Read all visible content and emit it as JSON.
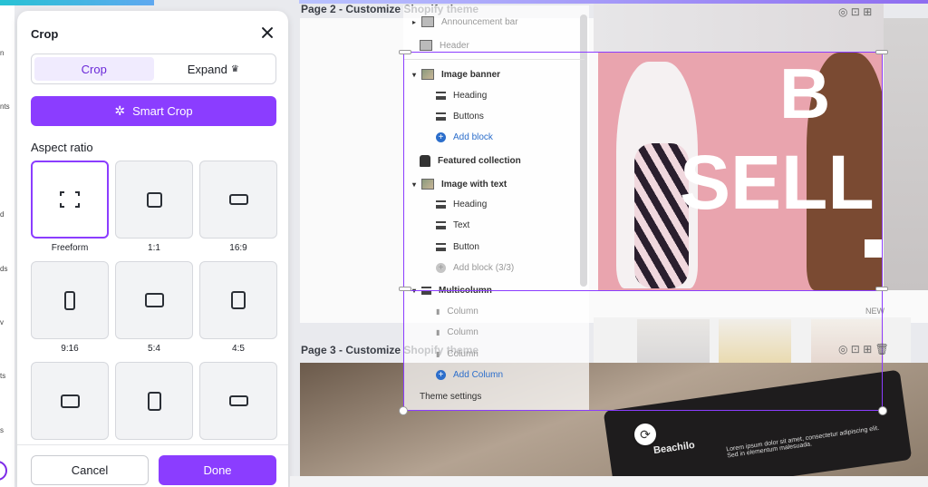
{
  "rail": {
    "labels": [
      "n",
      "nts",
      "d",
      "ds",
      "v",
      "ts",
      "s"
    ]
  },
  "panel": {
    "title": "Crop",
    "tabs": [
      {
        "label": "Crop",
        "active": true
      },
      {
        "label": "Expand",
        "icon": "crown-icon"
      }
    ],
    "smart_crop_label": "Smart Crop",
    "aspect_ratio_label": "Aspect ratio",
    "ratios": [
      {
        "label": "Freeform",
        "selected": true
      },
      {
        "label": "1:1"
      },
      {
        "label": "16:9"
      },
      {
        "label": "9:16"
      },
      {
        "label": "5:4"
      },
      {
        "label": "4:5"
      },
      {
        "label": ""
      },
      {
        "label": ""
      },
      {
        "label": ""
      }
    ],
    "cancel_label": "Cancel",
    "done_label": "Done"
  },
  "canvas": {
    "page2_title": "Page 2 - Customize Shopify theme",
    "page3_title": "Page 3 - Customize Shopify theme",
    "hero_text_1": "B",
    "hero_text_2": "SELL",
    "badge_new": "NEW",
    "product_brand": "Beachilo",
    "product_blurb": "Lorem ipsum dolor sit amet, consectetur adipiscing elit. Sed in elementum malesuada."
  },
  "layers": {
    "items": [
      {
        "label": "Announcement bar",
        "icon": "section-icon",
        "style": "muted"
      },
      {
        "label": "Header",
        "icon": "section-icon",
        "style": "muted"
      },
      {
        "label": "Image banner",
        "icon": "image-thumb-icon",
        "style": "section"
      },
      {
        "label": "Heading",
        "icon": "text-lines-icon",
        "style": "block"
      },
      {
        "label": "Buttons",
        "icon": "text-lines-icon",
        "style": "block"
      },
      {
        "label": "Add block",
        "icon": "add-icon",
        "style": "add"
      },
      {
        "label": "Featured collection",
        "icon": "bag-icon",
        "style": "section"
      },
      {
        "label": "Image with text",
        "icon": "image-thumb-icon",
        "style": "section"
      },
      {
        "label": "Heading",
        "icon": "text-lines-icon",
        "style": "block"
      },
      {
        "label": "Text",
        "icon": "text-lines-icon",
        "style": "block"
      },
      {
        "label": "Button",
        "icon": "text-lines-icon",
        "style": "block"
      },
      {
        "label": "Add block (3/3)",
        "icon": "add-icon",
        "style": "add-disabled"
      },
      {
        "label": "Multicolumn",
        "icon": "columns-icon",
        "style": "section"
      },
      {
        "label": "Column",
        "icon": "column-icon",
        "style": "block-muted"
      },
      {
        "label": "Column",
        "icon": "column-icon",
        "style": "block-muted"
      },
      {
        "label": "Column",
        "icon": "column-icon",
        "style": "block-muted"
      },
      {
        "label": "Add Column",
        "icon": "add-icon",
        "style": "add"
      },
      {
        "label": "Theme settings",
        "icon": "",
        "style": "footer"
      }
    ]
  },
  "colors": {
    "accent": "#8b3dff",
    "accent_soft": "#f0ebfe",
    "link": "#2c6ecb"
  }
}
